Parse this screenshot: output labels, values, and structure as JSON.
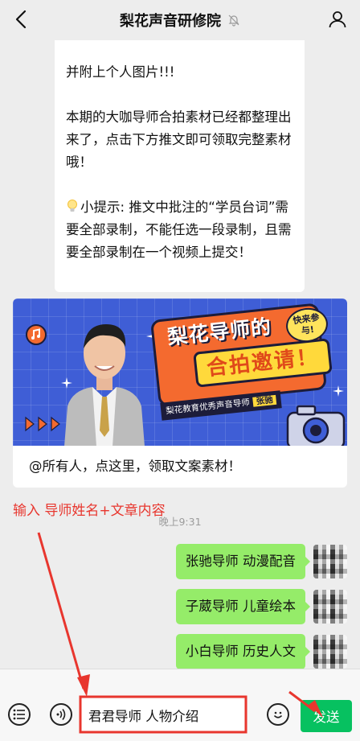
{
  "header": {
    "title": "梨花声音研修院",
    "back_icon": "chevron-left-icon",
    "mute_icon": "bell-muted-icon",
    "profile_icon": "person-icon"
  },
  "article": {
    "line1": "并附上个人图片!!!",
    "line2": "本期的大咖导师合拍素材已经都整理出来了，点击下方推文即可领取完整素材哦！",
    "tip": "小提示: 推文中批注的“学员台词”需要全部录制，不能任选一段录制，且需要全部录制在一个视频上提交！"
  },
  "promo": {
    "headline_1": "梨花导师的",
    "headline_2": "合拍邀请！",
    "sticker": "快来参与!",
    "caption": "梨花教育优秀声音导师",
    "caption_name": "张驰",
    "link_text": "@所有人，点这里，领取文案素材！"
  },
  "annotation": {
    "text": "输入 导师姓名+文章内容",
    "color": "#e8362e"
  },
  "timestamp": "晚上9:31",
  "messages": [
    {
      "text": "张驰导师 动漫配音"
    },
    {
      "text": "子葳导师 儿童绘本"
    },
    {
      "text": "小白导师 历史人文"
    }
  ],
  "input_bar": {
    "menu_icon": "list-menu-icon",
    "voice_icon": "voice-icon",
    "input_value": "君君导师 人物介绍",
    "emoji_icon": "emoji-icon",
    "send_label": "发送"
  },
  "colors": {
    "chat_bg": "#ededed",
    "bubble_green": "#95ec69",
    "send_green": "#07c160",
    "banner_blue": "#3f5ed6",
    "banner_orange": "#f46a2f"
  }
}
